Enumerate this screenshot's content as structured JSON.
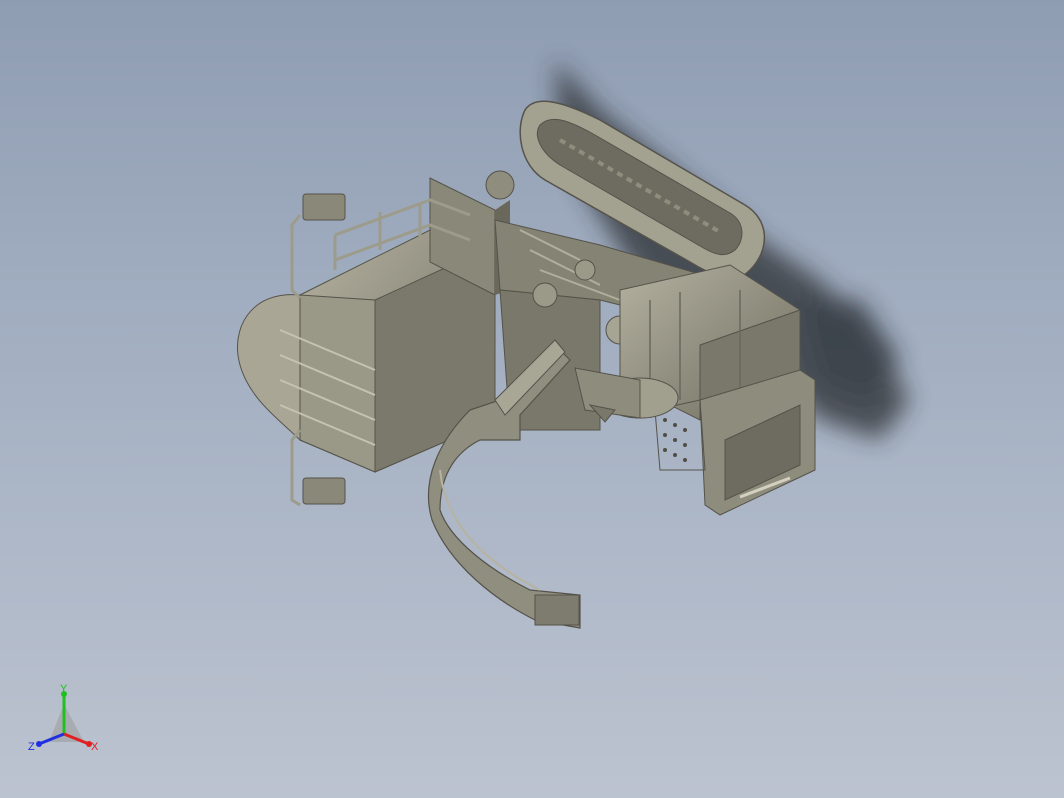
{
  "viewport": {
    "background_top": "#8f9db3",
    "background_bottom": "#bcc3d0",
    "model_color": "#8e8c7c",
    "model_shadow_color": "#2a2d33"
  },
  "triad": {
    "x_label": "X",
    "y_label": "Y",
    "z_label": "Z",
    "x_color": "#e02020",
    "y_color": "#20c020",
    "z_color": "#2030e0"
  }
}
